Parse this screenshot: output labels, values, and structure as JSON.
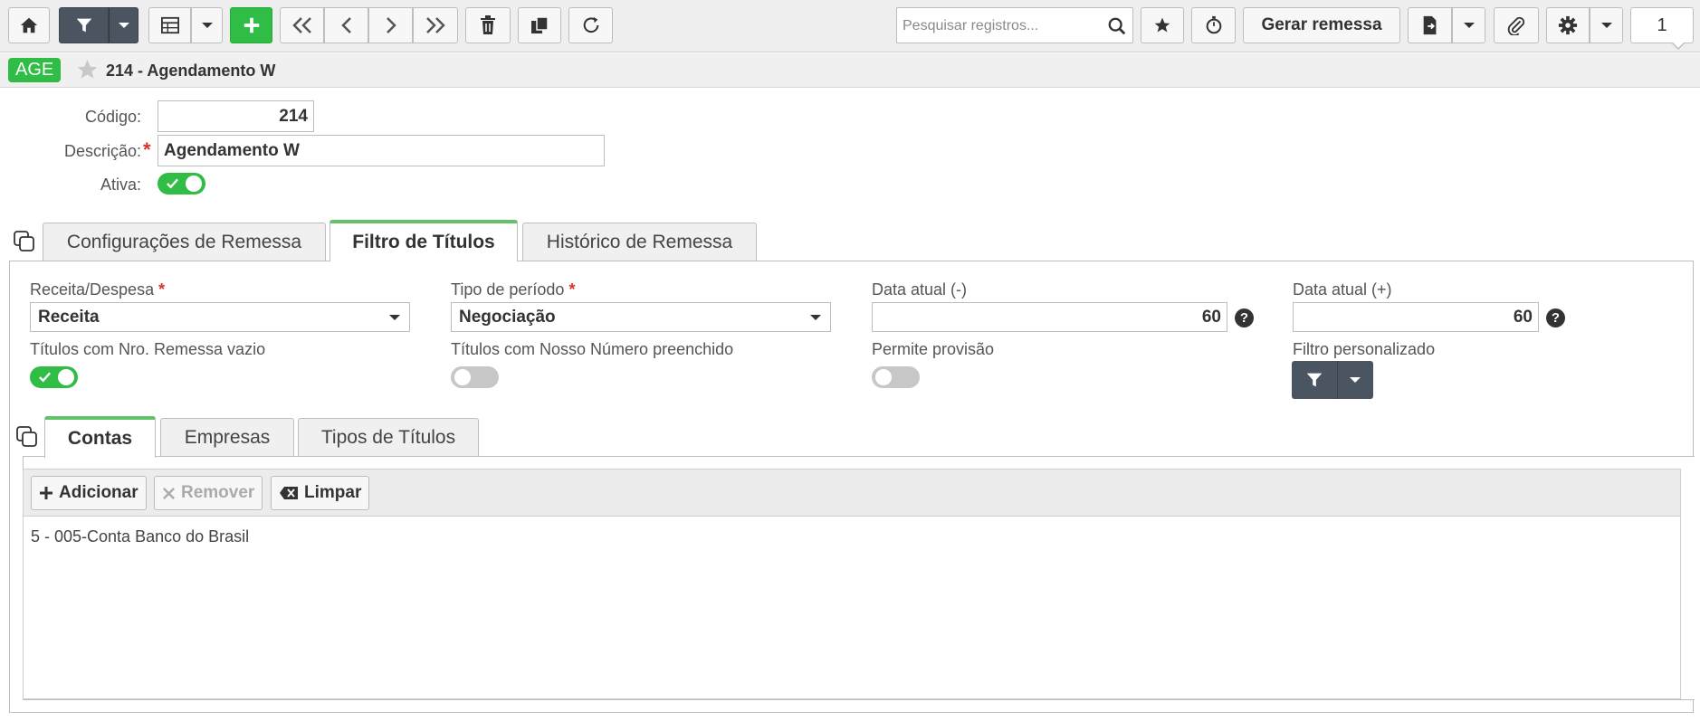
{
  "toolbar": {
    "search_placeholder": "Pesquisar registros...",
    "generate_label": "Gerar remessa",
    "page_number": "1"
  },
  "record": {
    "badge": "AGE",
    "title": "214 - Agendamento W"
  },
  "form": {
    "code_label": "Código:",
    "code_value": "214",
    "description_label": "Descrição:",
    "description_value": "Agendamento W",
    "active_label": "Ativa:",
    "active": true,
    "required_mark": "*"
  },
  "tabs": [
    {
      "label": "Configurações de Remessa",
      "active": false
    },
    {
      "label": "Filtro de Títulos",
      "active": true
    },
    {
      "label": "Histórico de Remessa",
      "active": false
    }
  ],
  "filter": {
    "revenue_label": "Receita/Despesa",
    "revenue_value": "Receita",
    "period_label": "Tipo de período",
    "period_value": "Negociação",
    "date_minus_label": "Data atual (-)",
    "date_minus_value": "60",
    "date_plus_label": "Data atual (+)",
    "date_plus_value": "60",
    "empty_remittance_label": "Títulos com Nro. Remessa vazio",
    "empty_remittance": true,
    "our_number_label": "Títulos com Nosso Número preenchido",
    "our_number": false,
    "provision_label": "Permite provisão",
    "provision": false,
    "custom_filter_label": "Filtro personalizado",
    "help_symbol": "?"
  },
  "subtabs": [
    {
      "label": "Contas",
      "active": true
    },
    {
      "label": "Empresas",
      "active": false
    },
    {
      "label": "Tipos de Títulos",
      "active": false
    }
  ],
  "accounts": {
    "add_label": "Adicionar",
    "remove_label": "Remover",
    "clear_label": "Limpar",
    "items": [
      "5 - 005-Conta Banco do Brasil"
    ]
  },
  "colors": {
    "accent_green": "#2fbd46",
    "dark_button": "#4a5561",
    "required": "#d9342b"
  }
}
